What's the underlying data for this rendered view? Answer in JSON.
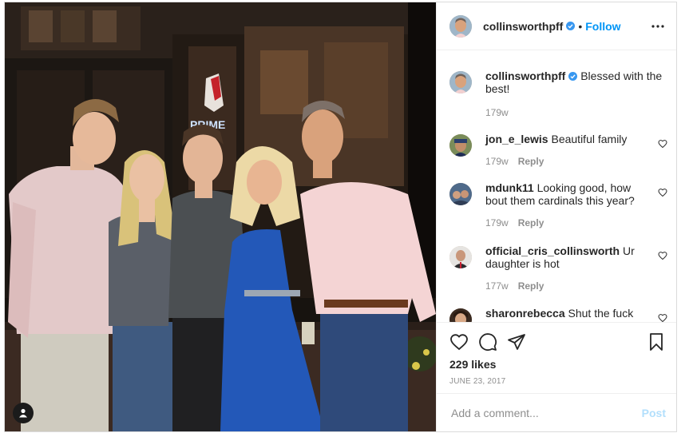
{
  "post": {
    "photo_alt": "Five people posing at night outside a restaurant",
    "sign_text": "PRIME"
  },
  "header": {
    "username": "collinsworthpff",
    "separator": "•",
    "follow_label": "Follow",
    "more_icon": "more-horizontal-icon"
  },
  "caption": {
    "username": "collinsworthpff",
    "text": "Blessed with the best!",
    "age": "179w"
  },
  "comments": [
    {
      "username": "jon_e_lewis",
      "text": "Beautiful family",
      "age": "179w",
      "reply_label": "Reply"
    },
    {
      "username": "mdunk11",
      "text": "Looking good, how bout them cardinals this year?",
      "age": "179w",
      "reply_label": "Reply"
    },
    {
      "username": "official_cris_collinsworth",
      "text": "Ur daughter is hot",
      "age": "177w",
      "reply_label": "Reply"
    },
    {
      "username": "sharonrebecca",
      "text": "Shut the fuck up!"
    }
  ],
  "actions": {
    "likes": "229 likes",
    "date": "JUNE 23, 2017"
  },
  "add_comment": {
    "placeholder": "Add a comment...",
    "post_label": "Post"
  },
  "colors": {
    "link_blue": "#0095f6",
    "post_disabled": "#b2dffc",
    "muted": "#8e8e8e",
    "text": "#262626"
  }
}
